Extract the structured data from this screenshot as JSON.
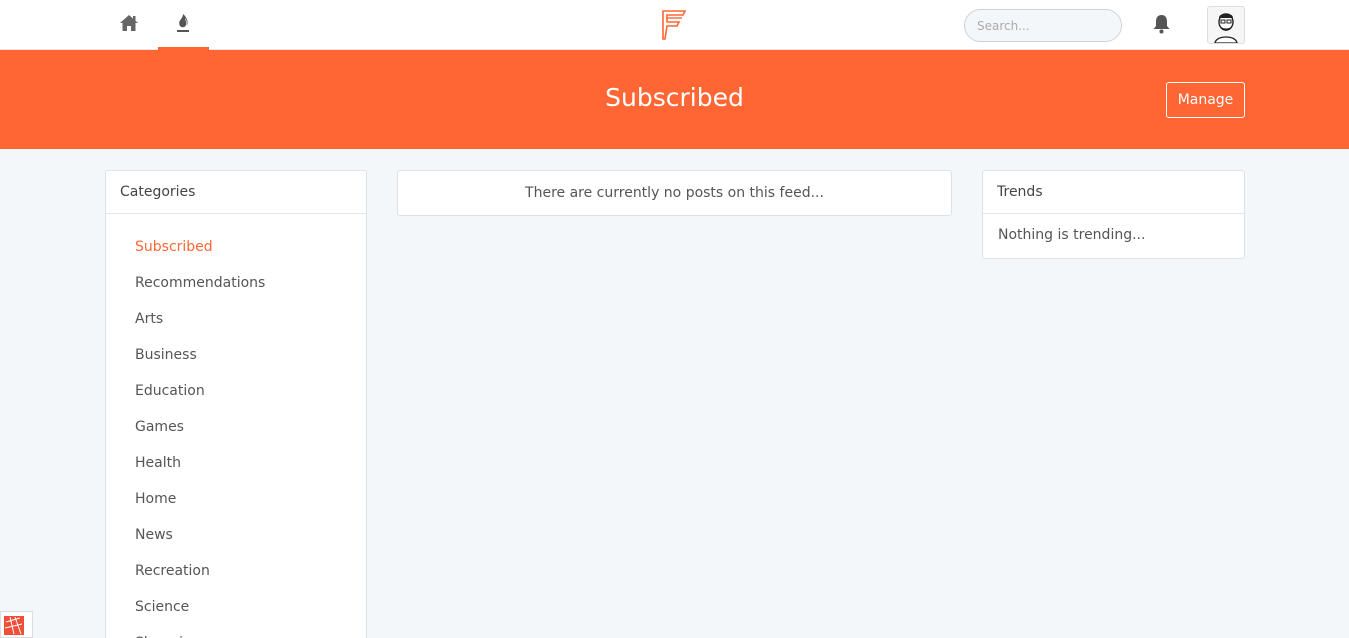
{
  "nav": {
    "home_icon": "home-icon",
    "trending_icon": "flame-icon",
    "logo_icon": "f-logo-icon",
    "search_placeholder": "Search...",
    "bell_icon": "bell-icon",
    "avatar_icon": "user-avatar-icon"
  },
  "banner": {
    "title": "Subscribed",
    "manage_label": "Manage"
  },
  "categories": {
    "header": "Categories",
    "items": [
      {
        "label": "Subscribed",
        "active": true
      },
      {
        "label": "Recommendations"
      },
      {
        "label": "Arts"
      },
      {
        "label": "Business"
      },
      {
        "label": "Education"
      },
      {
        "label": "Games"
      },
      {
        "label": "Health"
      },
      {
        "label": "Home"
      },
      {
        "label": "News"
      },
      {
        "label": "Recreation"
      },
      {
        "label": "Science"
      },
      {
        "label": "Shopping"
      }
    ]
  },
  "feed": {
    "empty_message": "There are currently no posts on this feed..."
  },
  "trends": {
    "header": "Trends",
    "empty_message": "Nothing is trending..."
  },
  "colors": {
    "accent": "#ff6633",
    "background": "#f4f7f9"
  }
}
